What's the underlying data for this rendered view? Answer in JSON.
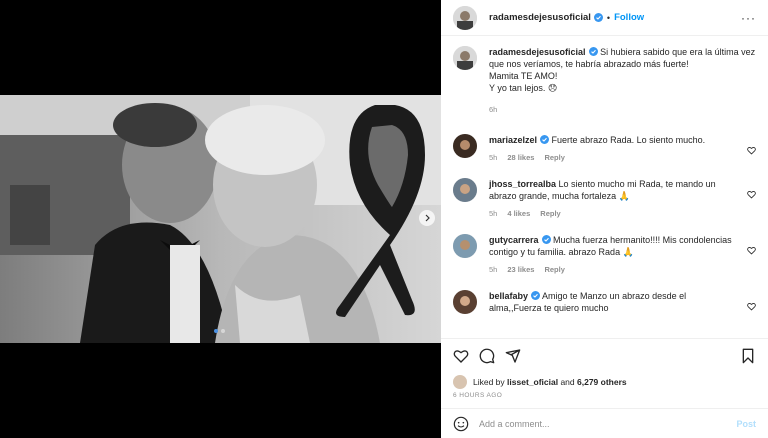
{
  "header": {
    "username": "radamesdejesusoficial",
    "separator": "•",
    "follow_label": "Follow",
    "more_label": "···"
  },
  "caption": {
    "author": "radamesdejesusoficial",
    "text_line1": "Si hubiera sabido que era la última vez que nos veríamos, te habría abrazado más fuerte!",
    "text_line2": "Mamita TE AMO!",
    "text_line3": "Y yo tan lejos. 😞",
    "time": "6h"
  },
  "comments": [
    {
      "author": "mariazelzel",
      "text": "Fuerte abrazo Rada. Lo siento mucho.",
      "time": "5h",
      "likes": "28 likes",
      "reply": "Reply"
    },
    {
      "author": "jhoss_torrealba",
      "text": "Lo siento mucho mi Rada, te mando un abrazo grande, mucha fortaleza 🙏",
      "time": "5h",
      "likes": "4 likes",
      "reply": "Reply"
    },
    {
      "author": "gutycarrera",
      "text": "Mucha fuerza hermanito!!!! Mis condolencias contigo y tu familia. abrazo Rada 🙏",
      "time": "5h",
      "likes": "23 likes",
      "reply": "Reply"
    },
    {
      "author": "bellafaby",
      "text": "Amigo te Manzo un abrazo desde el alma,,Fuerza te quiero mucho",
      "time": "",
      "likes": "",
      "reply": ""
    }
  ],
  "likes_line": {
    "prefix": "Liked by",
    "user": "lisset_oficial",
    "middle": "and",
    "count": "6,279 others"
  },
  "timestamp": "6 HOURS AGO",
  "add_comment": {
    "placeholder": "Add a comment...",
    "post_label": "Post"
  },
  "colors": {
    "link_blue": "#0095f6",
    "muted": "#8e8e8e",
    "text": "#262626",
    "post_disabled": "#b2dffc",
    "carousel_active": "#4a90e2"
  },
  "icons": [
    "verified-badge-icon",
    "more-options-icon",
    "heart-icon",
    "comment-icon",
    "share-icon",
    "bookmark-icon",
    "emoji-icon",
    "chevron-right-icon",
    "mourning-ribbon-icon"
  ],
  "carousel": {
    "slide_count": 2,
    "active_index": 0
  }
}
